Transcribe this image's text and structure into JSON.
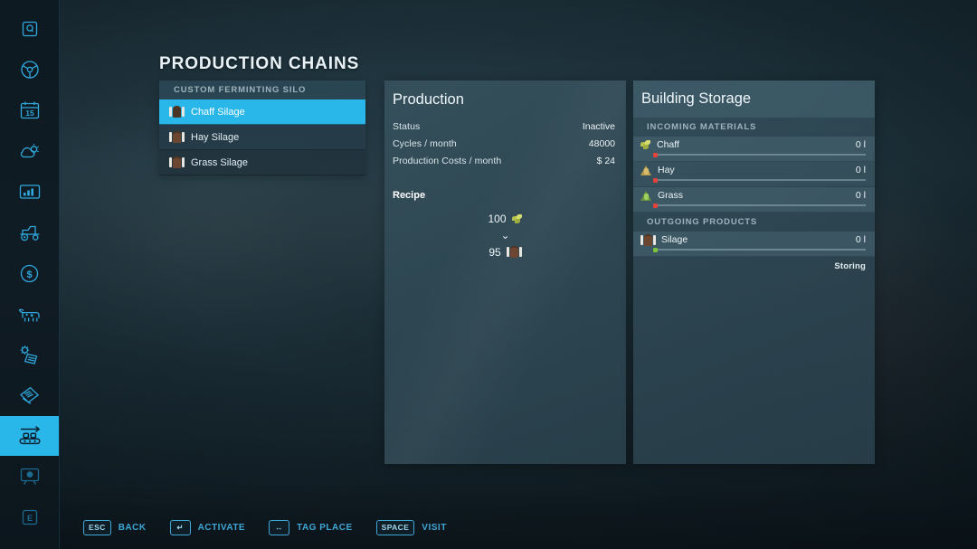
{
  "page": {
    "title": "PRODUCTION CHAINS"
  },
  "colors": {
    "accent": "#29b6e8",
    "key_blue": "#3fa7d6",
    "status_empty": "#e0423c",
    "status_ok": "#7bc23c",
    "panel_bg": "#30495a",
    "text_primary": "#eef5f8",
    "text_muted": "#9fb3bd"
  },
  "sidebar": {
    "items": [
      {
        "icon": "quest-q-icon",
        "name": "sidebar-item-quests",
        "active": false
      },
      {
        "icon": "steering-wheel-icon",
        "name": "sidebar-item-vehicles",
        "active": false
      },
      {
        "icon": "calendar-15-icon",
        "name": "sidebar-item-calendar",
        "active": false
      },
      {
        "icon": "weather-icon",
        "name": "sidebar-item-weather",
        "active": false
      },
      {
        "icon": "bar-chart-icon",
        "name": "sidebar-item-statistics",
        "active": false
      },
      {
        "icon": "tractor-icon",
        "name": "sidebar-item-machinery",
        "active": false
      },
      {
        "icon": "dollar-circle-icon",
        "name": "sidebar-item-finances",
        "active": false
      },
      {
        "icon": "cow-icon",
        "name": "sidebar-item-animals",
        "active": false
      },
      {
        "icon": "gear-document-icon",
        "name": "sidebar-item-contracts",
        "active": false
      },
      {
        "icon": "documents-icon",
        "name": "sidebar-item-prices",
        "active": false
      },
      {
        "icon": "conveyor-belt-icon",
        "name": "sidebar-item-production",
        "active": true
      },
      {
        "icon": "monitor-icon",
        "name": "sidebar-item-map-overview",
        "active": false
      },
      {
        "icon": "key-e-icon",
        "name": "sidebar-item-help",
        "active": false
      }
    ]
  },
  "chain_list": {
    "header": "CUSTOM FERMINTING SILO",
    "items": [
      {
        "label": "Chaff Silage",
        "selected": true,
        "icon": "silage-bale-icon"
      },
      {
        "label": "Hay Silage",
        "selected": false,
        "icon": "silage-bale-icon"
      },
      {
        "label": "Grass Silage",
        "selected": false,
        "icon": "silage-bale-icon"
      }
    ]
  },
  "production": {
    "title": "Production",
    "stats": [
      {
        "label": "Status",
        "value": "Inactive"
      },
      {
        "label": "Cycles / month",
        "value": "48000"
      },
      {
        "label": "Production Costs / month",
        "value": "$ 24"
      }
    ],
    "recipe_label": "Recipe",
    "recipe": {
      "input": {
        "amount": "100",
        "icon": "chaff-icon",
        "fill_name": "Chaff"
      },
      "arrow": "chevron-down-icon",
      "output": {
        "amount": "95",
        "icon": "silage-bale-icon",
        "fill_name": "Silage"
      }
    }
  },
  "storage": {
    "title": "Building Storage",
    "sections": [
      {
        "header": "INCOMING MATERIALS",
        "rows": [
          {
            "name": "Chaff",
            "amount": "0 l",
            "icon": "chaff-icon",
            "status": "empty",
            "fill_pct": 0
          },
          {
            "name": "Hay",
            "amount": "0 l",
            "icon": "hay-icon",
            "status": "empty",
            "fill_pct": 0
          },
          {
            "name": "Grass",
            "amount": "0 l",
            "icon": "grass-icon",
            "status": "empty",
            "fill_pct": 0
          }
        ]
      },
      {
        "header": "OUTGOING PRODUCTS",
        "rows": [
          {
            "name": "Silage",
            "amount": "0 l",
            "icon": "silage-bale-icon",
            "status": "ok",
            "fill_pct": 0,
            "note": "Storing"
          }
        ]
      }
    ]
  },
  "helpbar": {
    "hints": [
      {
        "key": "ESC",
        "label": "BACK"
      },
      {
        "key": "↵",
        "label": "ACTIVATE"
      },
      {
        "key": "↔",
        "label": "TAG PLACE"
      },
      {
        "key": "SPACE",
        "label": "VISIT"
      }
    ]
  }
}
